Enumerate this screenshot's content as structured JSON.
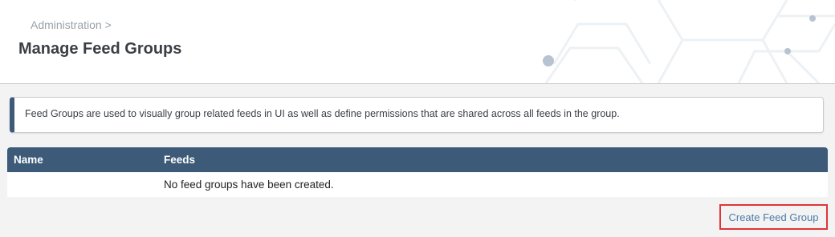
{
  "header": {
    "breadcrumb": "Administration >",
    "title": "Manage Feed Groups"
  },
  "info": {
    "text": "Feed Groups are used to visually group related feeds in UI as well as define permissions that are shared across all feeds in the group."
  },
  "table": {
    "columns": [
      "Name",
      "Feeds"
    ],
    "empty_message": "No feed groups have been created."
  },
  "actions": {
    "create_label": "Create Feed Group"
  },
  "colors": {
    "accent": "#3d5a78",
    "link": "#4d7aa8",
    "highlight_border": "#e0343a"
  }
}
